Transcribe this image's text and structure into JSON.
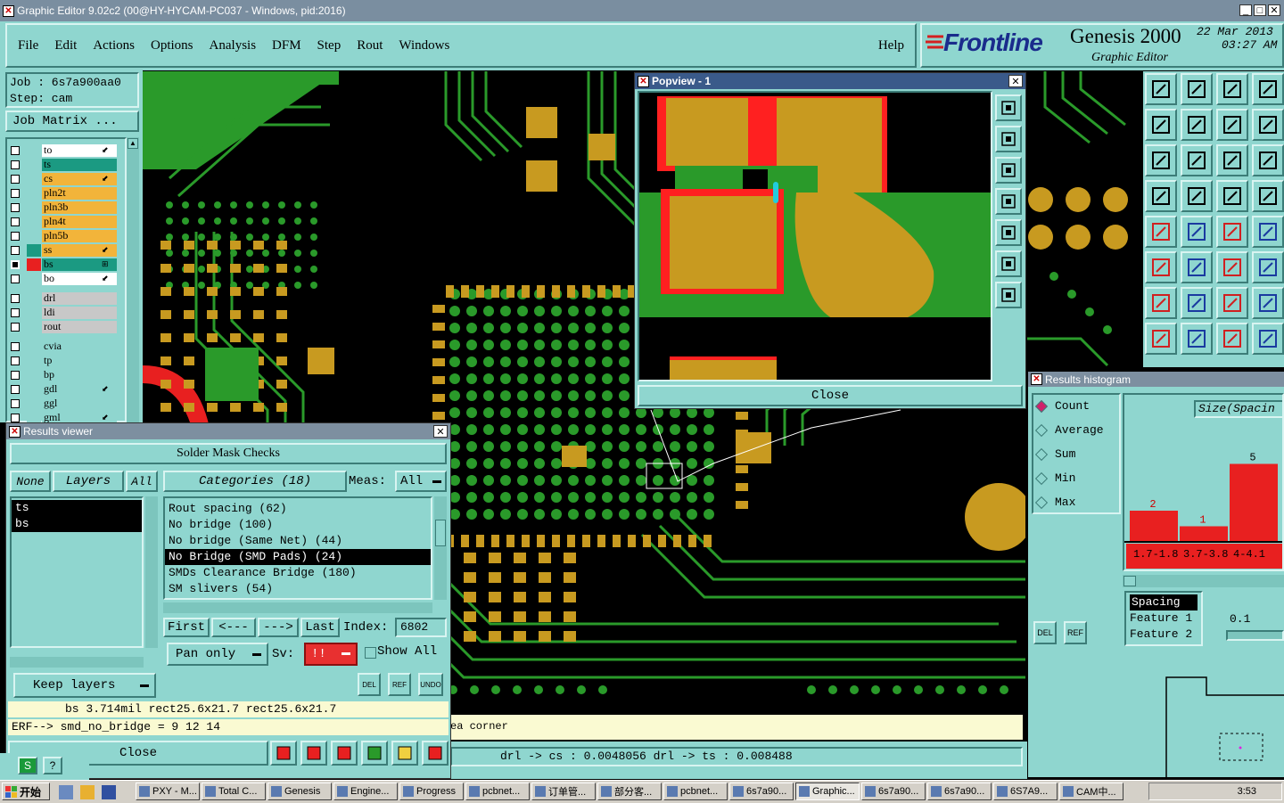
{
  "window": {
    "title": "Graphic Editor 9.02c2 (00@HY-HYCAM-PC037 - Windows, pid:2016)"
  },
  "menu": {
    "items": [
      "File",
      "Edit",
      "Actions",
      "Options",
      "Analysis",
      "DFM",
      "Step",
      "Rout",
      "Windows"
    ],
    "help": "Help"
  },
  "brand": {
    "logo": "Frontline",
    "product": "Genesis 2000",
    "subtitle": "Graphic Editor",
    "date": "22 Mar 2013",
    "time": "03:27 AM"
  },
  "job": {
    "job_label": "Job  : 6s7a900aa0",
    "step_label": "Step: cam",
    "matrix_button": "Job Matrix ..."
  },
  "layers": {
    "group1": [
      {
        "name": "to",
        "color": "#ffffff",
        "mark": "⬋"
      },
      {
        "name": "ts",
        "color": "#1b9a82",
        "mark": ""
      },
      {
        "name": "cs",
        "color": "#f2b43a",
        "mark": "⬋"
      },
      {
        "name": "pln2t",
        "color": "#f2b43a",
        "mark": ""
      },
      {
        "name": "pln3b",
        "color": "#f2b43a",
        "mark": ""
      },
      {
        "name": "pln4t",
        "color": "#f2b43a",
        "mark": ""
      },
      {
        "name": "pln5b",
        "color": "#f2b43a",
        "mark": ""
      },
      {
        "name": "ss",
        "color": "#f2b43a",
        "mark": "⬋"
      },
      {
        "name": "bs",
        "color": "#1b9a82",
        "mark": "⊞"
      },
      {
        "name": "bo",
        "color": "#ffffff",
        "mark": "⬋"
      }
    ],
    "group2": [
      {
        "name": "drl",
        "color": "#c8c8c8"
      },
      {
        "name": "ldi",
        "color": "#c8c8c8"
      },
      {
        "name": "rout",
        "color": "#c8c8c8"
      }
    ],
    "group3": [
      {
        "name": "cvia",
        "color": "#8fd6cf"
      },
      {
        "name": "tp",
        "color": "#8fd6cf"
      },
      {
        "name": "bp",
        "color": "#8fd6cf"
      },
      {
        "name": "gdl",
        "color": "#8fd6cf",
        "mark": "⬋"
      },
      {
        "name": "ggl",
        "color": "#8fd6cf"
      },
      {
        "name": "gml",
        "color": "#8fd6cf",
        "mark": "⬋"
      }
    ]
  },
  "results_viewer": {
    "title": "Results viewer",
    "header": "Solder Mask Checks",
    "none_btn": "None",
    "layers_btn": "Layers",
    "all_btn": "All",
    "categories_btn": "Categories (18)",
    "meas_label": "Meas:",
    "meas_value": "All",
    "layer_list": [
      "ts",
      "bs"
    ],
    "categories": [
      "Rout spacing (62)",
      "No bridge (100)",
      "No bridge (Same Net) (44)",
      "No Bridge (SMD Pads) (24)",
      "SMDs Clearance Bridge (180)",
      "SM slivers (54)"
    ],
    "selected_category": 3,
    "first_btn": "First",
    "prev_btn": "<---",
    "next_btn": "--->",
    "last_btn": "Last",
    "index_label": "Index:",
    "index_value": "6802",
    "pan_label": "Pan only",
    "sv_label": "Sv:",
    "sv_value": "!!",
    "show_all": "Show All",
    "keep_layers": "Keep layers",
    "del_btn": "DEL",
    "ref_btn": "REF",
    "undo_btn": "UNDO",
    "measure_line": "bs 3.714mil   rect25.6x21.7   rect25.6x21.7",
    "erf_line": "ERF--> smd_no_bridge = 9 12 14",
    "close_btn": "Close"
  },
  "popview": {
    "title": "Popview - 1",
    "close_btn": "Close"
  },
  "histogram": {
    "title": "Results histogram",
    "modes": [
      "Count",
      "Average",
      "Sum",
      "Min",
      "Max"
    ],
    "selected_mode": 0,
    "axis_label": "Size(Spacin",
    "chart_data": {
      "type": "bar",
      "categories": [
        "1.7-1.8",
        "3.7-3.8",
        "4-4.1"
      ],
      "values": [
        2,
        1,
        5
      ]
    },
    "info": [
      "Spacing",
      "Feature 1",
      "Feature 2"
    ],
    "value": "0.1",
    "del_btn": "DEL",
    "ref_btn": "REF"
  },
  "status": {
    "message": "ea corner",
    "drill_info": "drl -> cs : 0.0048056    drl -> ts : 0.008488"
  },
  "taskbar": {
    "start": "开始",
    "items": [
      "PXY - M...",
      "Total C...",
      "Genesis",
      "Engine...",
      "Progress",
      "pcbnet...",
      "订单管...",
      "部分客...",
      "pcbnet...",
      "6s7a90...",
      "Graphic...",
      "6s7a90...",
      "6s7a90...",
      "6S7A9...",
      "CAM中..."
    ],
    "clock": "3:53"
  }
}
